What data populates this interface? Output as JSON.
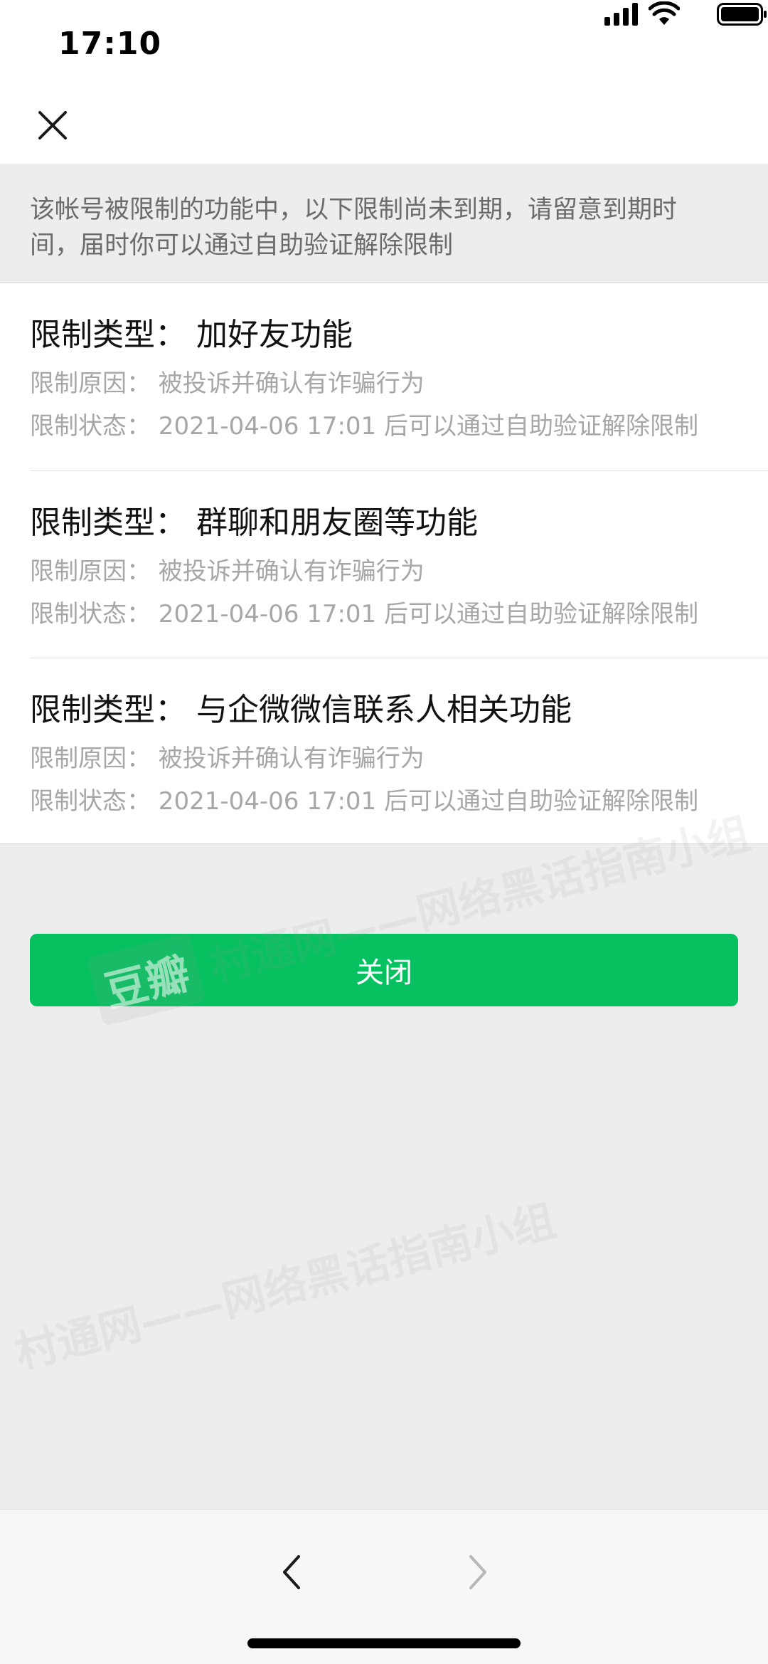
{
  "status_bar": {
    "time": "17:10"
  },
  "notice": "该帐号被限制的功能中，以下限制尚未到期，请留意到期时间，届时你可以通过自助验证解除限制",
  "restrictions": [
    {
      "title": "限制类型：  加好友功能",
      "reason": "限制原因：  被投诉并确认有诈骗行为",
      "status": "限制状态：  2021-04-06 17:01 后可以通过自助验证解除限制"
    },
    {
      "title": "限制类型：  群聊和朋友圈等功能",
      "reason": "限制原因：  被投诉并确认有诈骗行为",
      "status": "限制状态：  2021-04-06 17:01 后可以通过自助验证解除限制"
    },
    {
      "title": "限制类型：  与企微微信联系人相关功能",
      "reason": "限制原因：  被投诉并确认有诈骗行为",
      "status": "限制状态：  2021-04-06 17:01 后可以通过自助验证解除限制"
    }
  ],
  "close_button_label": "关闭",
  "watermark": {
    "logo": "豆瓣",
    "text": "村通网——网络黑话指南小组"
  },
  "colors": {
    "accent": "#07c160",
    "background": "#ededed",
    "secondary_text": "#a7a7a7"
  },
  "icons": {
    "close": "close-icon",
    "back": "chevron-left-icon",
    "forward": "chevron-right-icon"
  }
}
